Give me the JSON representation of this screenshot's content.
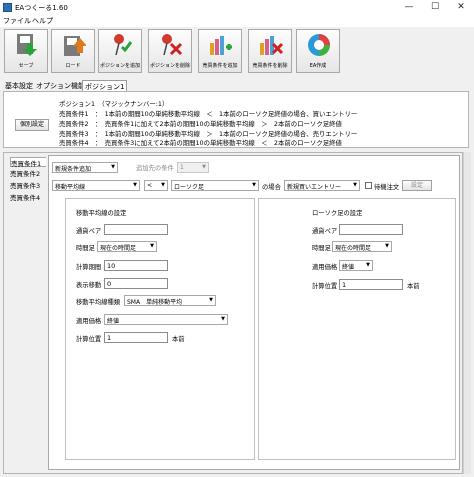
{
  "window": {
    "title": "EAつくーる1.60",
    "minimize": "—",
    "maximize": "☐",
    "close": "✕"
  },
  "menu": [
    "ファイル",
    "ヘルプ"
  ],
  "toolbar": [
    {
      "label": "セーブ",
      "icon": "save-icon"
    },
    {
      "label": "ロード",
      "icon": "load-icon"
    },
    {
      "label": "ポジションを追加",
      "icon": "add-position-icon"
    },
    {
      "label": "ポジションを削除",
      "icon": "delete-position-icon"
    },
    {
      "label": "売買条件を追加",
      "icon": "add-condition-icon"
    },
    {
      "label": "売買条件を削除",
      "icon": "delete-condition-icon"
    },
    {
      "label": "EA作成",
      "icon": "create-ea-icon"
    }
  ],
  "tabs": [
    "基本設定",
    "オプション機能",
    "ポジション1"
  ],
  "info": {
    "button": "個別設定",
    "lines": [
      "ポジション1　（マジックナンバー:1）",
      "売買条件1　：　1本前の期間10の単純移動平均線　＜　1本前のローソク足終値の場合、買いエントリー",
      "売買条件2　：　売買条件1に加えて2本前の期間10の単純移動平均線　＞　2本前のローソク足終値",
      "売買条件3　：　1本前の期間10の単純移動平均線　＞　1本前のローソク足終値の場合、売りエントリー",
      "売買条件4　：　売買条件3に加えて2本前の期間10の単純移動平均線　＜　2本前のローソク足終値"
    ]
  },
  "condition_tabs": [
    "売買条件1",
    "売買条件2",
    "売買条件3",
    "売買条件4"
  ],
  "row1": {
    "mode": "新規条件追加",
    "target_label": "追加先の条件",
    "target_value": "1"
  },
  "row2": {
    "left": "移動平均線",
    "op": "<",
    "right": "ローソク足",
    "suffix": "の場合",
    "action": "新規買いエントリー",
    "checkbox_label": "待機注文",
    "set_button": "設定"
  },
  "ma_group": {
    "title": "移動平均線の設定",
    "currency_label": "通貨ペア",
    "currency_value": "",
    "timeframe_label": "時間足",
    "timeframe_value": "現在の時間足",
    "period_label": "計算期間",
    "period_value": "10",
    "shift_label": "表示移動",
    "shift_value": "0",
    "type_label": "移動平均線種類",
    "type_value": "SMA　単純移動平均",
    "price_label": "適用価格",
    "price_value": "終値",
    "pos_label": "計算位置",
    "pos_value": "1",
    "pos_suffix": "本前"
  },
  "candle_group": {
    "title": "ローソク足の設定",
    "currency_label": "通貨ペア",
    "currency_value": "",
    "timeframe_label": "時間足",
    "timeframe_value": "現在の時間足",
    "price_label": "適用価格",
    "price_value": "終値",
    "pos_label": "計算位置",
    "pos_value": "1",
    "pos_suffix": "本前"
  }
}
